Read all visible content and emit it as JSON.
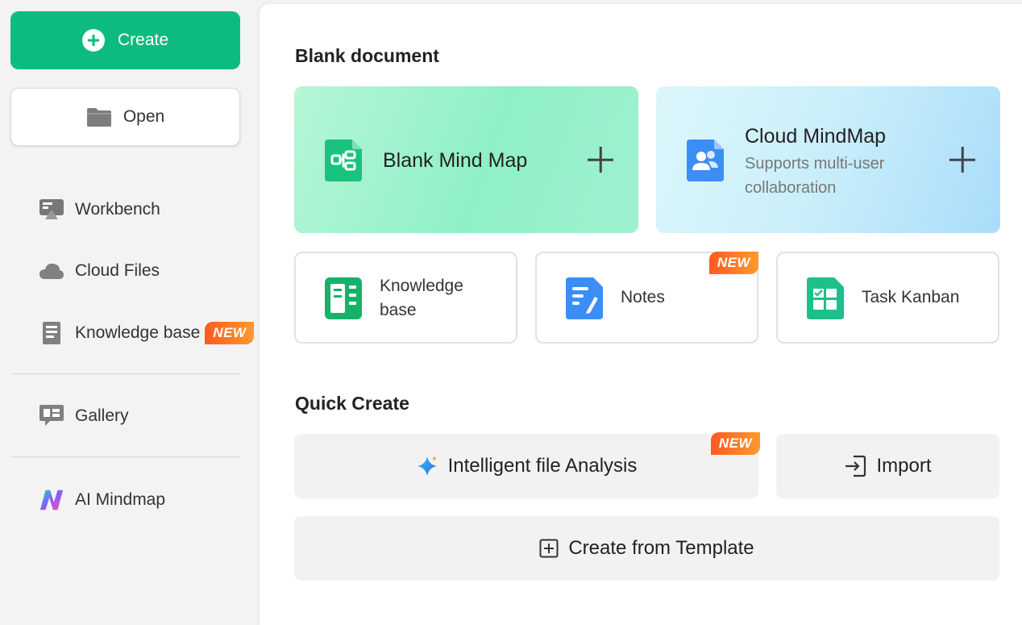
{
  "sidebar": {
    "create_label": "Create",
    "open_label": "Open",
    "items": [
      {
        "label": "Workbench",
        "icon": "workbench-icon"
      },
      {
        "label": "Cloud Files",
        "icon": "cloud-icon"
      },
      {
        "label": "Knowledge base",
        "icon": "book-icon",
        "badge": "NEW"
      },
      {
        "label": "Gallery",
        "icon": "gallery-icon"
      },
      {
        "label": "AI Mindmap",
        "icon": "ai-mindmap-logo-icon"
      }
    ]
  },
  "main": {
    "blank_title": "Blank document",
    "blank_mindmap": {
      "title": "Blank Mind Map",
      "icon": "mindmap-icon"
    },
    "cloud_mindmap": {
      "title": "Cloud MindMap",
      "subtitle": "Supports multi-user collaboration",
      "icon": "team-icon"
    },
    "cards": [
      {
        "label": "Knowledge base",
        "icon": "knowledge-icon"
      },
      {
        "label": "Notes",
        "icon": "notes-icon",
        "badge": "NEW"
      },
      {
        "label": "Task Kanban",
        "icon": "kanban-icon"
      }
    ],
    "quick_title": "Quick Create",
    "quick": {
      "analysis_label": "Intelligent file Analysis",
      "analysis_badge": "NEW",
      "import_label": "Import",
      "template_label": "Create from Template"
    }
  },
  "colors": {
    "accent": "#0ebb7f",
    "badge_start": "#ff5a1f",
    "badge_end": "#ff9a2e"
  }
}
